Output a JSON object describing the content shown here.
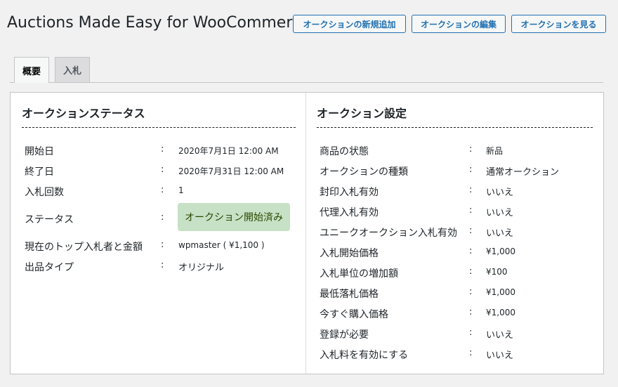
{
  "header": {
    "title": "Auctions Made Easy for WooCommerce",
    "buttons": {
      "add_new": "オークションの新規追加",
      "edit": "オークションの編集",
      "view": "オークションを見る"
    }
  },
  "tabs": {
    "overview": "概要",
    "bids": "入札"
  },
  "status_section": {
    "title": "オークションステータス",
    "separator": ":",
    "rows": {
      "start_date": {
        "label": "開始日",
        "value": "2020年7月1日 12:00 AM"
      },
      "end_date": {
        "label": "終了日",
        "value": "2020年7月31日 12:00 AM"
      },
      "bid_count": {
        "label": "入札回数",
        "value": "1"
      },
      "status": {
        "label": "ステータス",
        "value": "オークション開始済み"
      },
      "top_bidder": {
        "label": "現在のトップ入札者と金額",
        "value": "wpmaster ( ¥1,100 )"
      },
      "listing_type": {
        "label": "出品タイプ",
        "value": "オリジナル"
      }
    }
  },
  "settings_section": {
    "title": "オークション設定",
    "separator": ":",
    "rows": [
      {
        "label": "商品の状態",
        "value": "新品"
      },
      {
        "label": "オークションの種類",
        "value": "通常オークション"
      },
      {
        "label": "封印入札有効",
        "value": "いいえ"
      },
      {
        "label": "代理入札有効",
        "value": "いいえ"
      },
      {
        "label": "ユニークオークション入札有効",
        "value": "いいえ"
      },
      {
        "label": "入札開始価格",
        "value": "¥1,000"
      },
      {
        "label": "入札単位の増加額",
        "value": "¥100"
      },
      {
        "label": "最低落札価格",
        "value": "¥1,000"
      },
      {
        "label": "今すぐ購入価格",
        "value": "¥1,000"
      },
      {
        "label": "登録が必要",
        "value": "いいえ"
      },
      {
        "label": "入札料を有効にする",
        "value": "いいえ"
      }
    ]
  },
  "colors": {
    "accent": "#2271b1",
    "status_badge_bg": "#c6e1c6",
    "status_badge_text": "#2c4700",
    "page_bg": "#f1f1f1"
  }
}
